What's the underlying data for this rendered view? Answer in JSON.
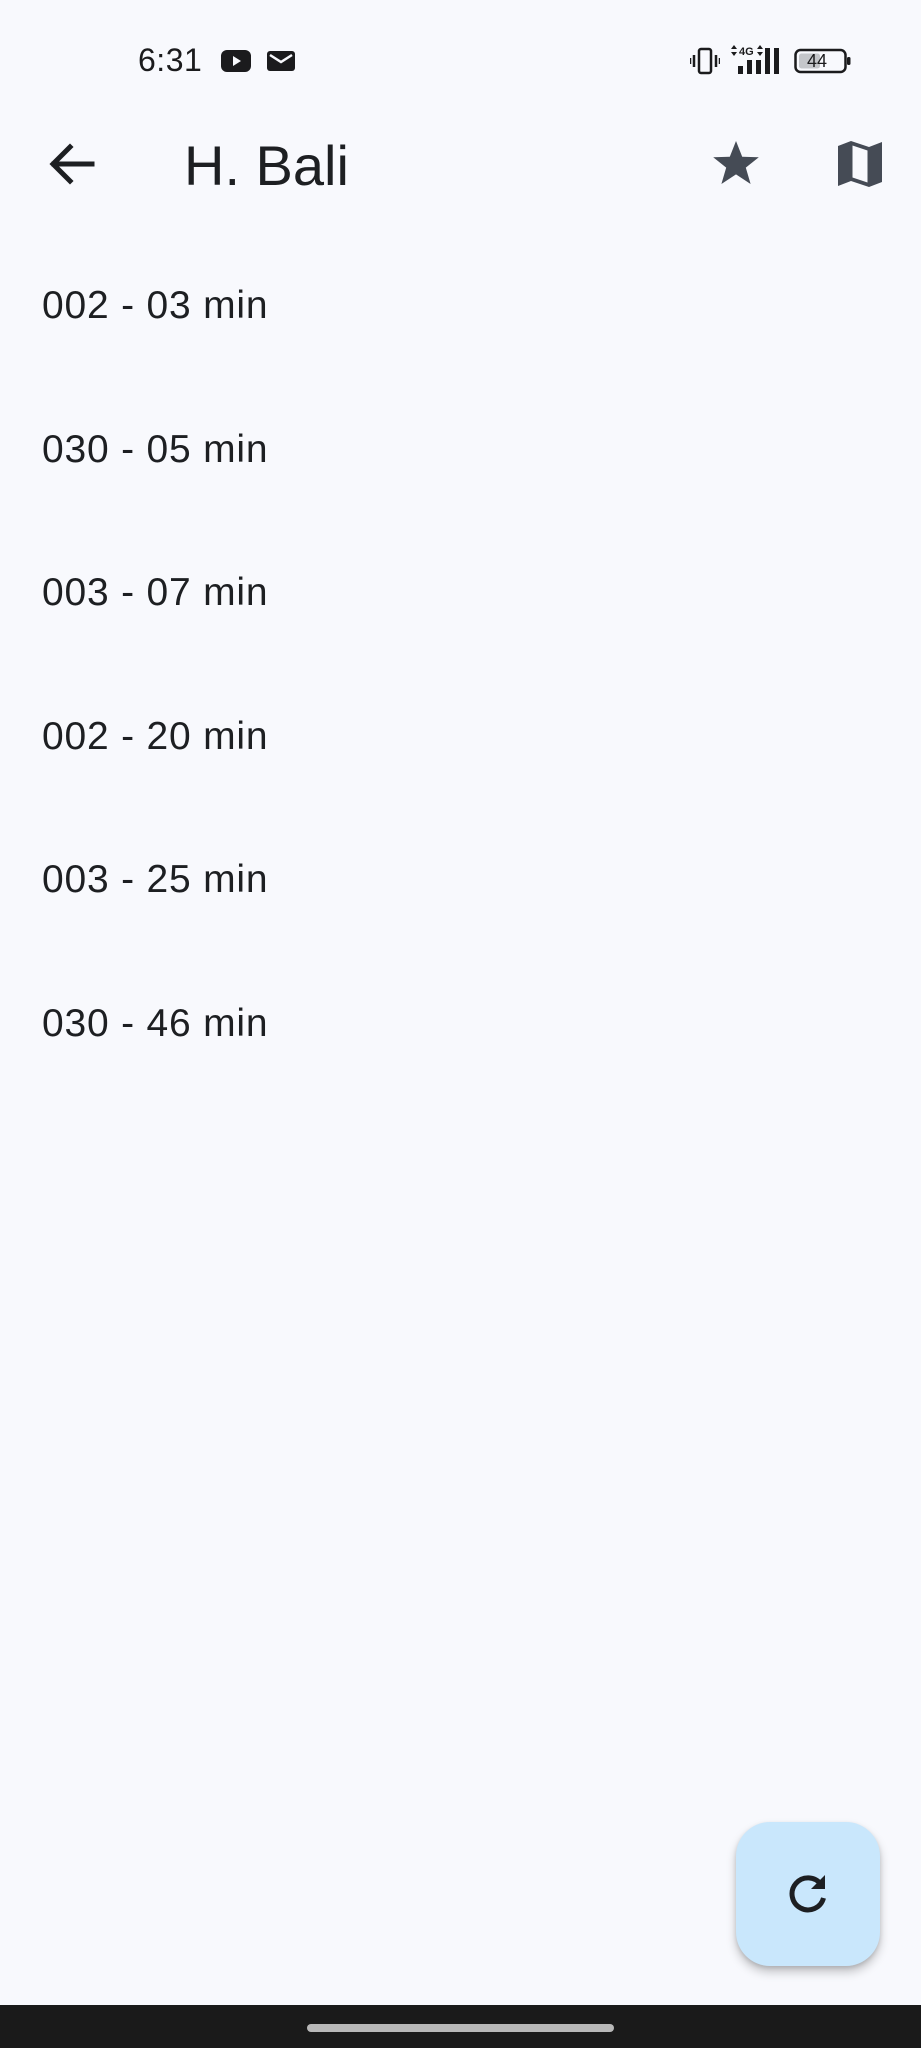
{
  "status_bar": {
    "time": "6:31",
    "network": "4G",
    "battery": "44",
    "icons": [
      "youtube-icon",
      "mail-icon",
      "vibrate-icon",
      "signal-icon",
      "battery-icon"
    ]
  },
  "app_bar": {
    "title": "H. Bali",
    "icons": [
      "back-arrow-icon",
      "star-icon",
      "map-icon"
    ]
  },
  "arrivals": [
    {
      "label": "002 - 03 min"
    },
    {
      "label": "030 - 05 min"
    },
    {
      "label": "003 - 07 min"
    },
    {
      "label": "002 - 20 min"
    },
    {
      "label": "003 - 25 min"
    },
    {
      "label": "030 - 46 min"
    }
  ],
  "fab": {
    "icon": "refresh-icon"
  },
  "colors": {
    "background": "#f8f9fd",
    "text": "#1d1f22",
    "icon": "#454b55",
    "fab_background": "#c9e7fc",
    "nav_bar": "#1a1a1a"
  }
}
